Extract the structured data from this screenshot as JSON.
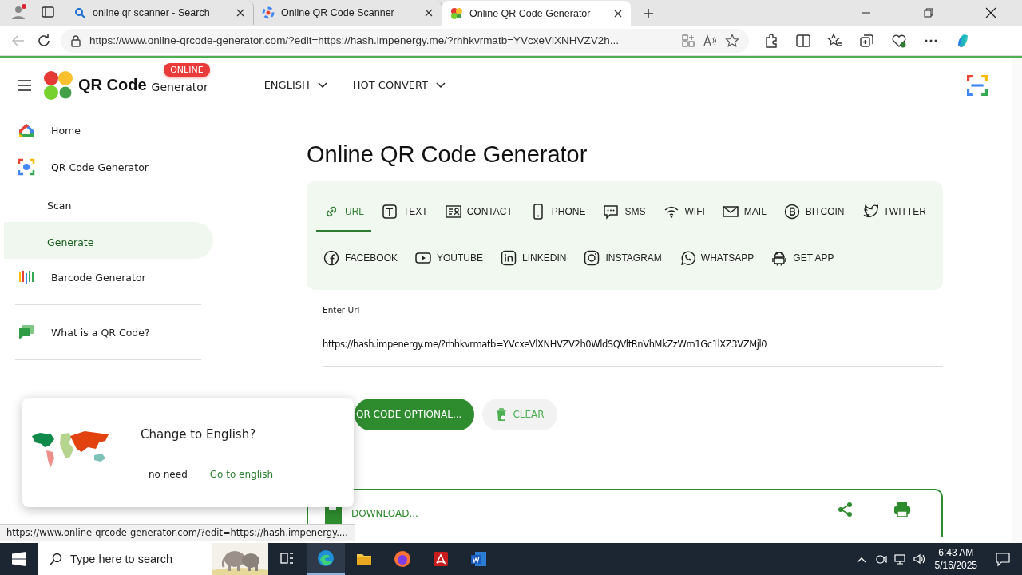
{
  "browser": {
    "tabs": [
      {
        "title": "online qr scanner - Search",
        "selected": false
      },
      {
        "title": "Online QR Code Scanner",
        "selected": false
      },
      {
        "title": "Online QR Code Generator",
        "selected": true
      }
    ],
    "url": "https://www.online-qrcode-generator.com/?edit=https://hash.impenergy.me/?rhhkvrmatb=YVcxeVlXNHVZV2h..."
  },
  "header": {
    "brand": "QR Code",
    "brand_sub": "Generator",
    "badge": "ONLINE",
    "menus": [
      {
        "label": "ENGLISH"
      },
      {
        "label": "HOT CONVERT"
      }
    ]
  },
  "sidebar": {
    "items": [
      {
        "label": "Home",
        "kind": "link",
        "selected": false
      },
      {
        "label": "QR Code Generator",
        "kind": "link",
        "selected": false
      },
      {
        "label": "Scan",
        "kind": "sub",
        "selected": false
      },
      {
        "label": "Generate",
        "kind": "sub",
        "selected": true
      },
      {
        "label": "Barcode Generator",
        "kind": "link",
        "selected": false
      },
      {
        "kind": "divider"
      },
      {
        "label": "What is a QR Code?",
        "kind": "link",
        "selected": false
      },
      {
        "kind": "divider"
      }
    ]
  },
  "main": {
    "title": "Online QR Code Generator",
    "types": [
      {
        "label": "URL",
        "selected": true
      },
      {
        "label": "TEXT",
        "selected": false
      },
      {
        "label": "CONTACT",
        "selected": false
      },
      {
        "label": "PHONE",
        "selected": false
      },
      {
        "label": "SMS",
        "selected": false
      },
      {
        "label": "WIFI",
        "selected": false
      },
      {
        "label": "MAIL",
        "selected": false
      },
      {
        "label": "BITCOIN",
        "selected": false
      },
      {
        "label": "TWITTER",
        "selected": false
      },
      {
        "label": "FACEBOOK",
        "selected": false
      },
      {
        "label": "YOUTUBE",
        "selected": false
      },
      {
        "label": "LINKEDIN",
        "selected": false
      },
      {
        "label": "INSTAGRAM",
        "selected": false
      },
      {
        "label": "WHATSAPP",
        "selected": false
      },
      {
        "label": "GET APP",
        "selected": false
      }
    ],
    "field": {
      "label": "Enter Url",
      "value": "https://hash.impenergy.me/?rhhkvrmatb=YVcxeVlXNHVZV2h0WldSQVltRnVhMkZzWm1Gc1lXZ3VZMjl0"
    },
    "buttons": [
      {
        "label": "QR CODE OPTIONAL...",
        "kind": "primary"
      },
      {
        "label": "CLEAR",
        "kind": "secondary"
      }
    ],
    "download": {
      "label": "DOWNLOAD..."
    }
  },
  "popup": {
    "title": "Change to English?",
    "buttons": [
      {
        "label": "no need",
        "kind": "plain"
      },
      {
        "label": "Go to english",
        "kind": "accent"
      }
    ]
  },
  "status_url": "https://www.online-qrcode-generator.com/?edit=https://hash.impenergy....",
  "taskbar": {
    "search_placeholder": "Type here to search",
    "time": "6:43 AM",
    "date": "5/16/2025"
  }
}
